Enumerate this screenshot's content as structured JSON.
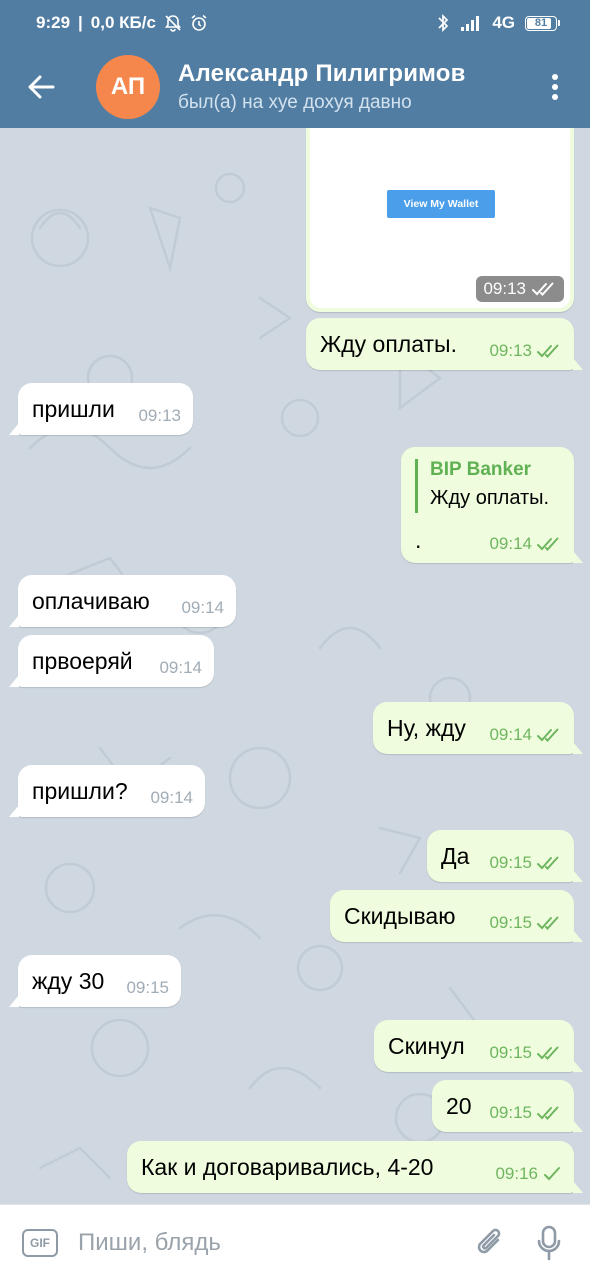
{
  "status_bar": {
    "time": "9:29",
    "speed": "0,0 КБ/с",
    "network": "4G",
    "battery": "81",
    "battery_level": 0.81
  },
  "header": {
    "avatar_initials": "АП",
    "contact_name": "Александр Пилигримов",
    "contact_status": "был(а) на хуе дохуя давно"
  },
  "colors": {
    "header_bg": "#517da2",
    "avatar_bg": "#f5874c",
    "outgoing_bubble": "#effdde",
    "incoming_bubble": "#ffffff",
    "reply_accent": "#5fb153",
    "wallet_button": "#4a9eea"
  },
  "messages": {
    "photo": {
      "button_label": "View My Wallet",
      "time": "09:13"
    },
    "m1": {
      "text": "Жду оплаты.",
      "time": "09:13"
    },
    "m2": {
      "text": "пришли",
      "time": "09:13"
    },
    "m3": {
      "reply_author": "BIP Banker",
      "reply_text": "Жду оплаты.",
      "text": ".",
      "time": "09:14"
    },
    "m4": {
      "text": "оплачиваю",
      "time": "09:14"
    },
    "m5": {
      "text": "првоеряй",
      "time": "09:14"
    },
    "m6": {
      "text": "Ну, жду",
      "time": "09:14"
    },
    "m7": {
      "text": "пришли?",
      "time": "09:14"
    },
    "m8": {
      "text": "Да",
      "time": "09:15"
    },
    "m9": {
      "text": "Скидываю",
      "time": "09:15"
    },
    "m10": {
      "text": "жду 30",
      "time": "09:15"
    },
    "m11": {
      "text": "Скинул",
      "time": "09:15"
    },
    "m12": {
      "text": "20",
      "time": "09:15"
    },
    "m13": {
      "text": "Как и договаривались, 4-20",
      "time": "09:16"
    }
  },
  "input": {
    "gif_label": "GIF",
    "placeholder": "Пиши, блядь"
  }
}
